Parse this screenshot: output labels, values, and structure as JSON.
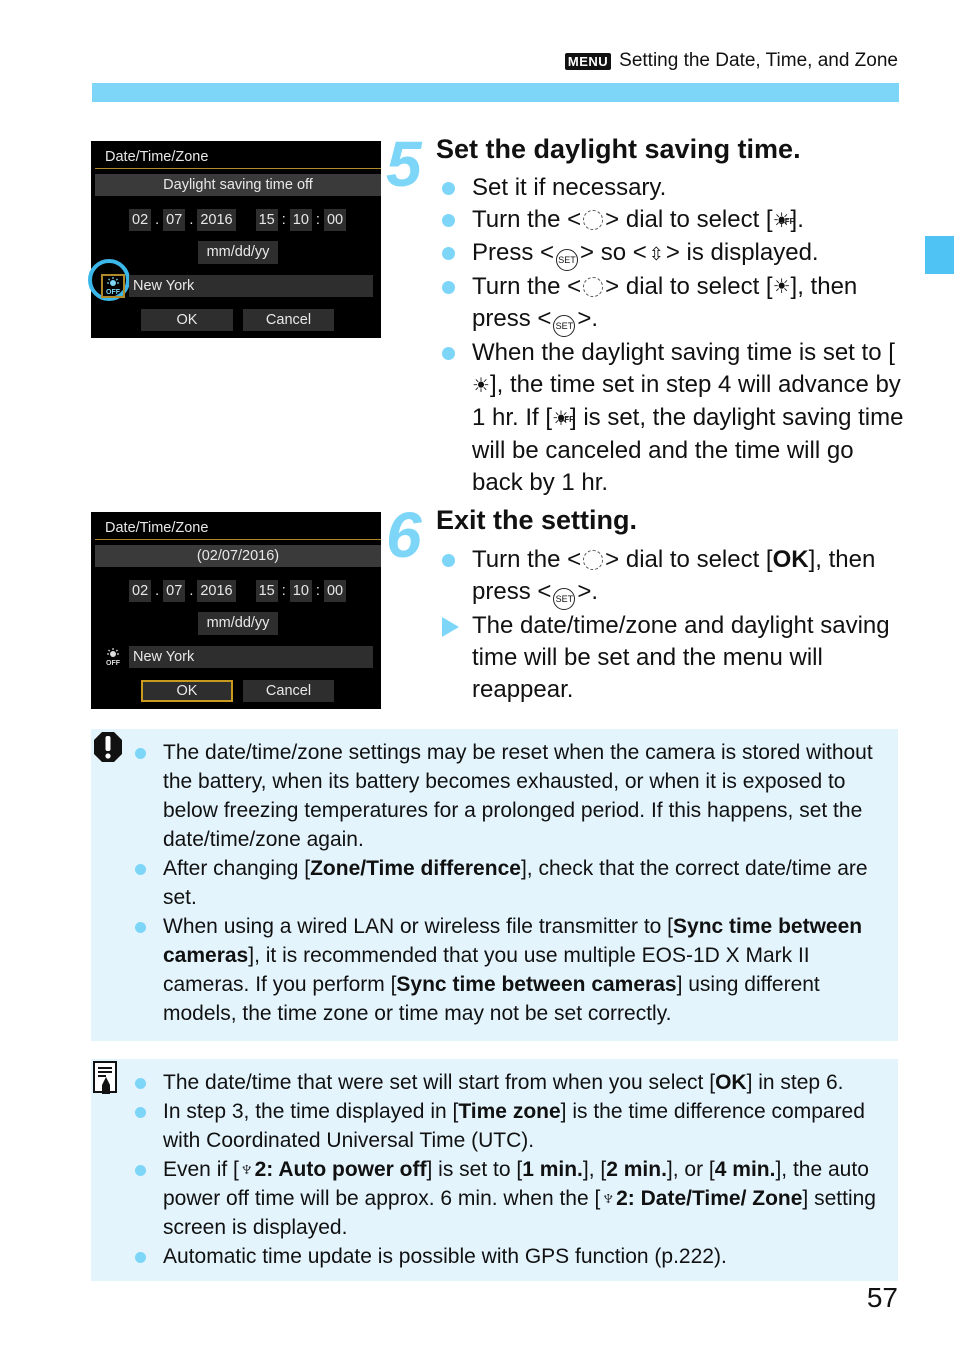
{
  "header": {
    "menu_badge": "MENU",
    "section_title": "Setting the Date, Time, and Zone"
  },
  "screens": [
    {
      "title": "Date/Time/Zone",
      "status": "Daylight saving time off",
      "month": "02",
      "day": "07",
      "year": "2016",
      "hour": "15",
      "minute": "10",
      "second": "00",
      "date_sep": ".",
      "time_sep": ":",
      "format": "mm/dd/yy",
      "dst_icon_label": "OFF",
      "zone": "New York",
      "ok": "OK",
      "cancel": "Cancel"
    },
    {
      "title": "Date/Time/Zone",
      "status": "(02/07/2016)",
      "month": "02",
      "day": "07",
      "year": "2016",
      "hour": "15",
      "minute": "10",
      "second": "00",
      "date_sep": ".",
      "time_sep": ":",
      "format": "mm/dd/yy",
      "dst_icon_label": "OFF",
      "zone": "New York",
      "ok": "OK",
      "cancel": "Cancel"
    }
  ],
  "steps": [
    {
      "number": "5",
      "title": "Set the daylight saving time.",
      "items": [
        {
          "type": "bullet",
          "parts": [
            "Set it if necessary."
          ]
        },
        {
          "type": "bullet",
          "parts": [
            "Turn the <",
            "[dial]",
            "> dial to select [",
            "[sun-off]",
            "]."
          ]
        },
        {
          "type": "bullet",
          "parts": [
            "Press <",
            "[set]",
            "> so <",
            "[updown]",
            "> is displayed."
          ]
        },
        {
          "type": "bullet",
          "parts": [
            "Turn the <",
            "[dial]",
            "> dial to select [",
            "[sun]",
            "], then press <",
            "[set]",
            ">."
          ]
        },
        {
          "type": "bullet",
          "parts": [
            "When the daylight saving time is set to [",
            "[sun]",
            "], the time set in step 4 will advance by 1 hr. If [",
            "[sun-off]",
            "] is set, the daylight saving time will be canceled and the time will go back by 1 hr."
          ]
        }
      ]
    },
    {
      "number": "6",
      "title": "Exit the setting.",
      "items": [
        {
          "type": "bullet",
          "parts": [
            "Turn the <",
            "[dial]",
            "> dial to select [",
            "**OK",
            "], then press <",
            "[set]",
            ">."
          ]
        },
        {
          "type": "arrow",
          "parts": [
            "The date/time/zone and daylight saving time will be set and the menu will reappear."
          ]
        }
      ]
    }
  ],
  "symbols": {
    "set_label": "SET",
    "sun_glyph": "☀",
    "sun_off_label": "OFF",
    "updown_glyph": "⇳"
  },
  "caution": {
    "icon": "caution-icon",
    "items": [
      [
        "The date/time/zone settings may be reset when the camera is stored without the battery, when its battery becomes exhausted, or when it is exposed to below freezing temperatures for a prolonged period. If this happens, set the date/time/zone again."
      ],
      [
        "After changing [",
        "**Zone/Time difference",
        "], check that the correct date/time are set."
      ],
      [
        "When using a wired LAN or wireless file transmitter to [",
        "**Sync time between cameras",
        "], it is recommended that you use multiple EOS-1D X Mark II cameras. If you perform [",
        "**Sync time between cameras",
        "] using different models, the time zone or time may not be set correctly."
      ]
    ]
  },
  "memo": {
    "icon": "memo-icon",
    "items": [
      [
        "The date/time that were set will start from when you select [",
        "**OK",
        "] in step 6."
      ],
      [
        "In step 3, the time displayed in [",
        "**Time zone",
        "] is the time difference compared with Coordinated Universal Time (UTC)."
      ],
      [
        "Even if [",
        "**♆2: Auto power off",
        "] is set to [",
        "**1 min.",
        "], [",
        "**2 min.",
        "], or [",
        "**4 min.",
        "], the auto power off time will be approx. 6 min. when the [",
        "**♆2: Date/Time/ Zone",
        "] setting screen is displayed."
      ],
      [
        "Automatic time update is possible with GPS function (p.222)."
      ]
    ]
  },
  "page_number": "57",
  "colors": {
    "accent": "#7dd6f8",
    "side_tab": "#4ec3f4",
    "note_bg": "#e3f4fd",
    "highlight_ring": "#3bb7ea",
    "selection_border": "#c89b1e"
  }
}
